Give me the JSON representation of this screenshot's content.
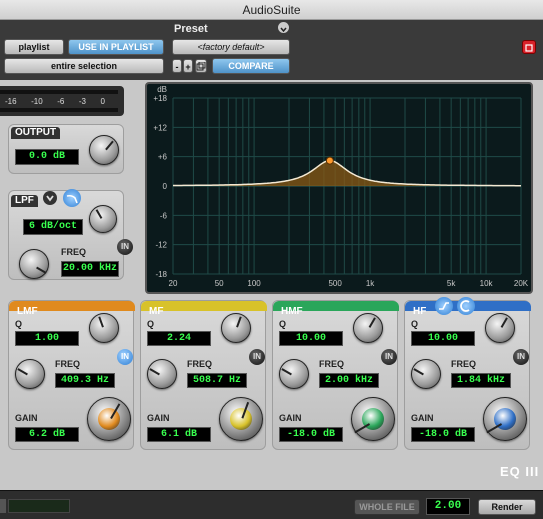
{
  "title": "AudioSuite",
  "header": {
    "preset_label": "Preset",
    "playlist_btn": "playlist",
    "use_in_playlist_btn": "USE IN PLAYLIST",
    "selection_mode": "entire selection",
    "preset_value": "<factory default>",
    "compare_btn": "COMPARE",
    "minus": "-",
    "plus": "+"
  },
  "meter": {
    "scale": [
      "-16",
      "-10",
      "-6",
      "-3",
      "0"
    ]
  },
  "output": {
    "label": "OUTPUT",
    "value": "0.0 dB"
  },
  "lpf": {
    "label": "LPF",
    "slope": "6 dB/oct",
    "freq_label": "FREQ",
    "freq": "20.00 kHz",
    "in": "IN"
  },
  "graph": {
    "y_ticks": [
      "dB",
      "+18",
      "+12",
      "+6",
      "0",
      "-6",
      "-12",
      "-18"
    ],
    "x_ticks": [
      "20",
      "50",
      "100",
      "500",
      "1k",
      "5k",
      "10k",
      "20K"
    ]
  },
  "bands": [
    {
      "label": "LMF",
      "q_label": "Q",
      "q": "1.00",
      "freq_label": "FREQ",
      "freq": "409.3 Hz",
      "gain_label": "GAIN",
      "gain": "6.2 dB",
      "in": "IN",
      "color": "#e08a1e"
    },
    {
      "label": "MF",
      "q_label": "Q",
      "q": "2.24",
      "freq_label": "FREQ",
      "freq": "508.7 Hz",
      "gain_label": "GAIN",
      "gain": "6.1 dB",
      "in": "IN",
      "color": "#d8c22a"
    },
    {
      "label": "HMF",
      "q_label": "Q",
      "q": "10.00",
      "freq_label": "FREQ",
      "freq": "2.00 kHz",
      "gain_label": "GAIN",
      "gain": "-18.0 dB",
      "in": "IN",
      "color": "#2aa65a"
    },
    {
      "label": "HF",
      "q_label": "Q",
      "q": "10.00",
      "freq_label": "FREQ",
      "freq": "1.84 kHz",
      "gain_label": "GAIN",
      "gain": "-18.0 dB",
      "in": "IN",
      "color": "#2f6fc6"
    }
  ],
  "brand": "EQ III",
  "footer": {
    "whole_file": "WHOLE FILE",
    "handle_value": "2.00",
    "render": "Render"
  }
}
